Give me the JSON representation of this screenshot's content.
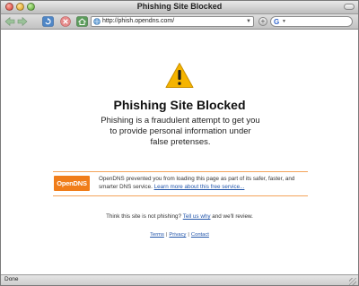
{
  "window": {
    "title": "Phishing Site Blocked"
  },
  "toolbar": {
    "url": "http://phish.opendns.com/",
    "search_engine_letter": "G"
  },
  "page": {
    "heading": "Phishing Site Blocked",
    "description": "Phishing is a fraudulent attempt to get you to provide personal information under false pretenses.",
    "logo_text": "OpenDNS",
    "notice_text": "OpenDNS prevented you from loading this page as part of its safer, faster, and smarter DNS service.",
    "notice_link": "Learn more about this free service...",
    "think_prefix": "Think this site is not phishing?",
    "think_link": "Tell us why",
    "think_suffix": "and we'll review.",
    "footer_links": [
      "Terms",
      "Privacy",
      "Contact"
    ],
    "footer_separator": "|"
  },
  "status": {
    "text": "Done"
  },
  "colors": {
    "accent_orange": "#f07d1a",
    "divider": "#f4a45a",
    "warning_yellow": "#f5b400",
    "link_blue": "#2255aa"
  },
  "icons": {
    "back": "back-arrow-icon",
    "forward": "forward-arrow-icon",
    "reload": "reload-icon",
    "stop": "stop-icon",
    "home": "home-icon",
    "warning": "warning-triangle-icon"
  }
}
